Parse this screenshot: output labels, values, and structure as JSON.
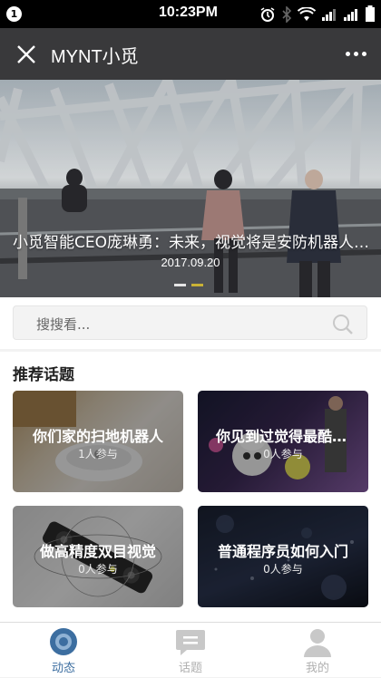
{
  "status_bar": {
    "badge": "1",
    "time": "10:23PM",
    "icons": [
      "alarm-icon",
      "bluetooth-icon",
      "wifi-icon",
      "signal-icon",
      "signal-icon",
      "battery-icon"
    ]
  },
  "nav": {
    "title": "MYNT小觅",
    "close_icon": "close-icon",
    "more_icon": "more-icon"
  },
  "banner": {
    "title": "小觅智能CEO庞琳勇：未来，视觉将是安防机器人的核心",
    "date": "2017.09.20",
    "slides_total": 2,
    "active_slide": 2
  },
  "search": {
    "placeholder": "搜搜看..."
  },
  "topics": {
    "heading": "推荐话题",
    "items": [
      {
        "title": "你们家的扫地机器人",
        "count": "1人参与"
      },
      {
        "title": "你见到过觉得最酷的机器人",
        "count": "0人参与"
      },
      {
        "title": "做高精度双目视觉",
        "count": "0人参与"
      },
      {
        "title": "普通程序员如何入门",
        "count": "0人参与"
      }
    ]
  },
  "tabs": {
    "items": [
      {
        "label": "动态",
        "active": true
      },
      {
        "label": "话题",
        "active": false
      },
      {
        "label": "我的",
        "active": false
      }
    ],
    "active_color": "#3c6ea0",
    "inactive_color": "#b0b0b0"
  }
}
